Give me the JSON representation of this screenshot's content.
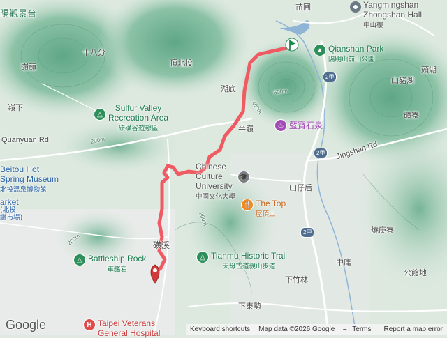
{
  "map": {
    "colors": {
      "route": "#ef5a63",
      "water": "#8fb4d6",
      "road": "#ffffff",
      "terrain_dark": "#7bb79d",
      "terrain_light": "#e3ece4"
    }
  },
  "labels": {
    "top_left_place": "陽觀景台",
    "miaopu": "苗圃",
    "shiba_fen": "十八分",
    "ling_tou": "嶺頭",
    "ding_bei_tou": "頂北投",
    "hu_di": "湖底",
    "ling_xia": "嶺下",
    "ban_ling": "半嶺",
    "shan_zhu_hu": "山豬湖",
    "tou_hu": "頭湖",
    "kuang_liao": "礦寮",
    "quanyuan_rd": "Quanyuan Rd",
    "jingshan_rd": "Jingshan Rd",
    "shan_zai_hou": "山仔后",
    "shao_geng_liao": "燒庚寮",
    "market_en": "arket",
    "market_zh1": "(北投",
    "market_zh2": "繼市場)",
    "zhong_pu": "中庸",
    "gong_guan_di": "公館地",
    "xia_zhu_lin": "下竹林",
    "xia_dong_shi": "下東勢",
    "gui_zi": "磺溪",
    "contour_600": "600m",
    "contour_400": "400m",
    "contour_200a": "200m",
    "contour_200b": "200m",
    "contour_200c": "200m",
    "route_2a": "2甲",
    "route_2b": "2甲",
    "route_2c": "2甲"
  },
  "pois": {
    "yangmingshan_hall_en1": "Yangmingshan",
    "yangmingshan_hall_en2": "Zhongshan Hall",
    "yangmingshan_hall_zh": "中山樓",
    "qianshan_en": "Qianshan Park",
    "qianshan_zh": "陽明山前山公園",
    "sulfur_en1": "Sulfur Valley",
    "sulfur_en2": "Recreation Area",
    "sulfur_zh": "硫磺谷遊憩區",
    "lanbao_zh": "藍寶石泉",
    "beitou_en1": "Beitou Hot",
    "beitou_en2": "Spring Museum",
    "beitou_zh": "北投溫泉博物館",
    "pccu_en1": "Chinese",
    "pccu_en2": "Culture",
    "pccu_en3": "University",
    "pccu_zh": "中國文化大學",
    "thetop_en": "The Top",
    "thetop_zh": "屋頂上",
    "battleship_en": "Battleship Rock",
    "battleship_zh": "軍艦岩",
    "tianmu_en": "Tianmu Historic Trail",
    "tianmu_zh": "天母古道親山步道",
    "veterans_en1": "Taipei Veterans",
    "veterans_en2": "General Hospital"
  },
  "footer": {
    "google": "Google",
    "keyboard": "Keyboard shortcuts",
    "map_data": "Map data ©2026 Google",
    "terms": "Terms",
    "report": "Report a map error"
  },
  "route": {
    "start_marker": "start-flag",
    "end_marker": "end-pin"
  }
}
